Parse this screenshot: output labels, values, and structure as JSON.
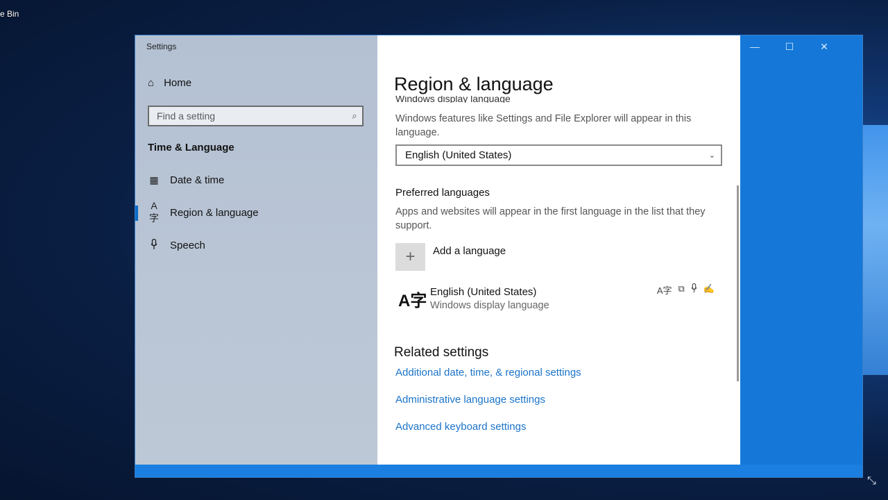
{
  "desktop": {
    "label": "e Bin"
  },
  "window": {
    "title": "Settings",
    "caption": {
      "minimize": "—",
      "maximize": "☐",
      "close": "✕"
    }
  },
  "nav": {
    "home_label": "Home",
    "search_placeholder": "Find a setting",
    "section": "Time & Language",
    "items": [
      {
        "label": "Date & time",
        "icon": "calendar-clock-icon"
      },
      {
        "label": "Region & language",
        "icon": "language-icon"
      },
      {
        "label": "Speech",
        "icon": "microphone-icon"
      }
    ]
  },
  "content": {
    "title": "Region & language",
    "display_language": {
      "heading": "Windows display language",
      "desc": "Windows features like Settings and File Explorer will appear in this language.",
      "selected": "English (United States)"
    },
    "preferred": {
      "heading": "Preferred languages",
      "desc": "Apps and websites will appear in the first language in the list that they support.",
      "add_label": "Add a language",
      "languages": [
        {
          "name": "English (United States)",
          "sub": "Windows display language"
        }
      ]
    },
    "related": {
      "heading": "Related settings",
      "links": [
        "Additional date, time, & regional settings",
        "Administrative language settings",
        "Advanced keyboard settings"
      ]
    }
  },
  "colors": {
    "accent": "#1a73c9",
    "nav_bg": "#b9c5d5",
    "window_frame": "#1578d8"
  }
}
